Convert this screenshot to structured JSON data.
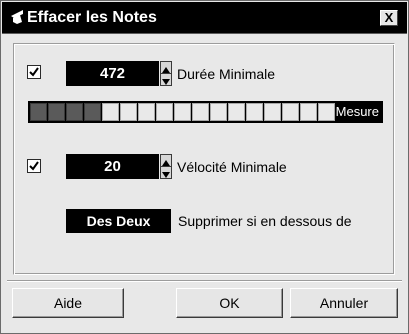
{
  "window": {
    "title": "Effacer les Notes",
    "title_icon": "brush-icon",
    "close_label": "X"
  },
  "duration": {
    "checked": true,
    "value": "472",
    "label": "Durée Minimale"
  },
  "bar": {
    "label": "Mesure",
    "filled_cells": 4,
    "total_cells": 17,
    "filled_color": "#5a5a5a",
    "empty_color": "#e9e9e9"
  },
  "velocity": {
    "checked": true,
    "value": "20",
    "label": "Vélocité Minimale"
  },
  "mode": {
    "button_label": "Des Deux",
    "description": "Supprimer si en dessous de"
  },
  "buttons": {
    "help": "Aide",
    "ok": "OK",
    "cancel": "Annuler"
  }
}
